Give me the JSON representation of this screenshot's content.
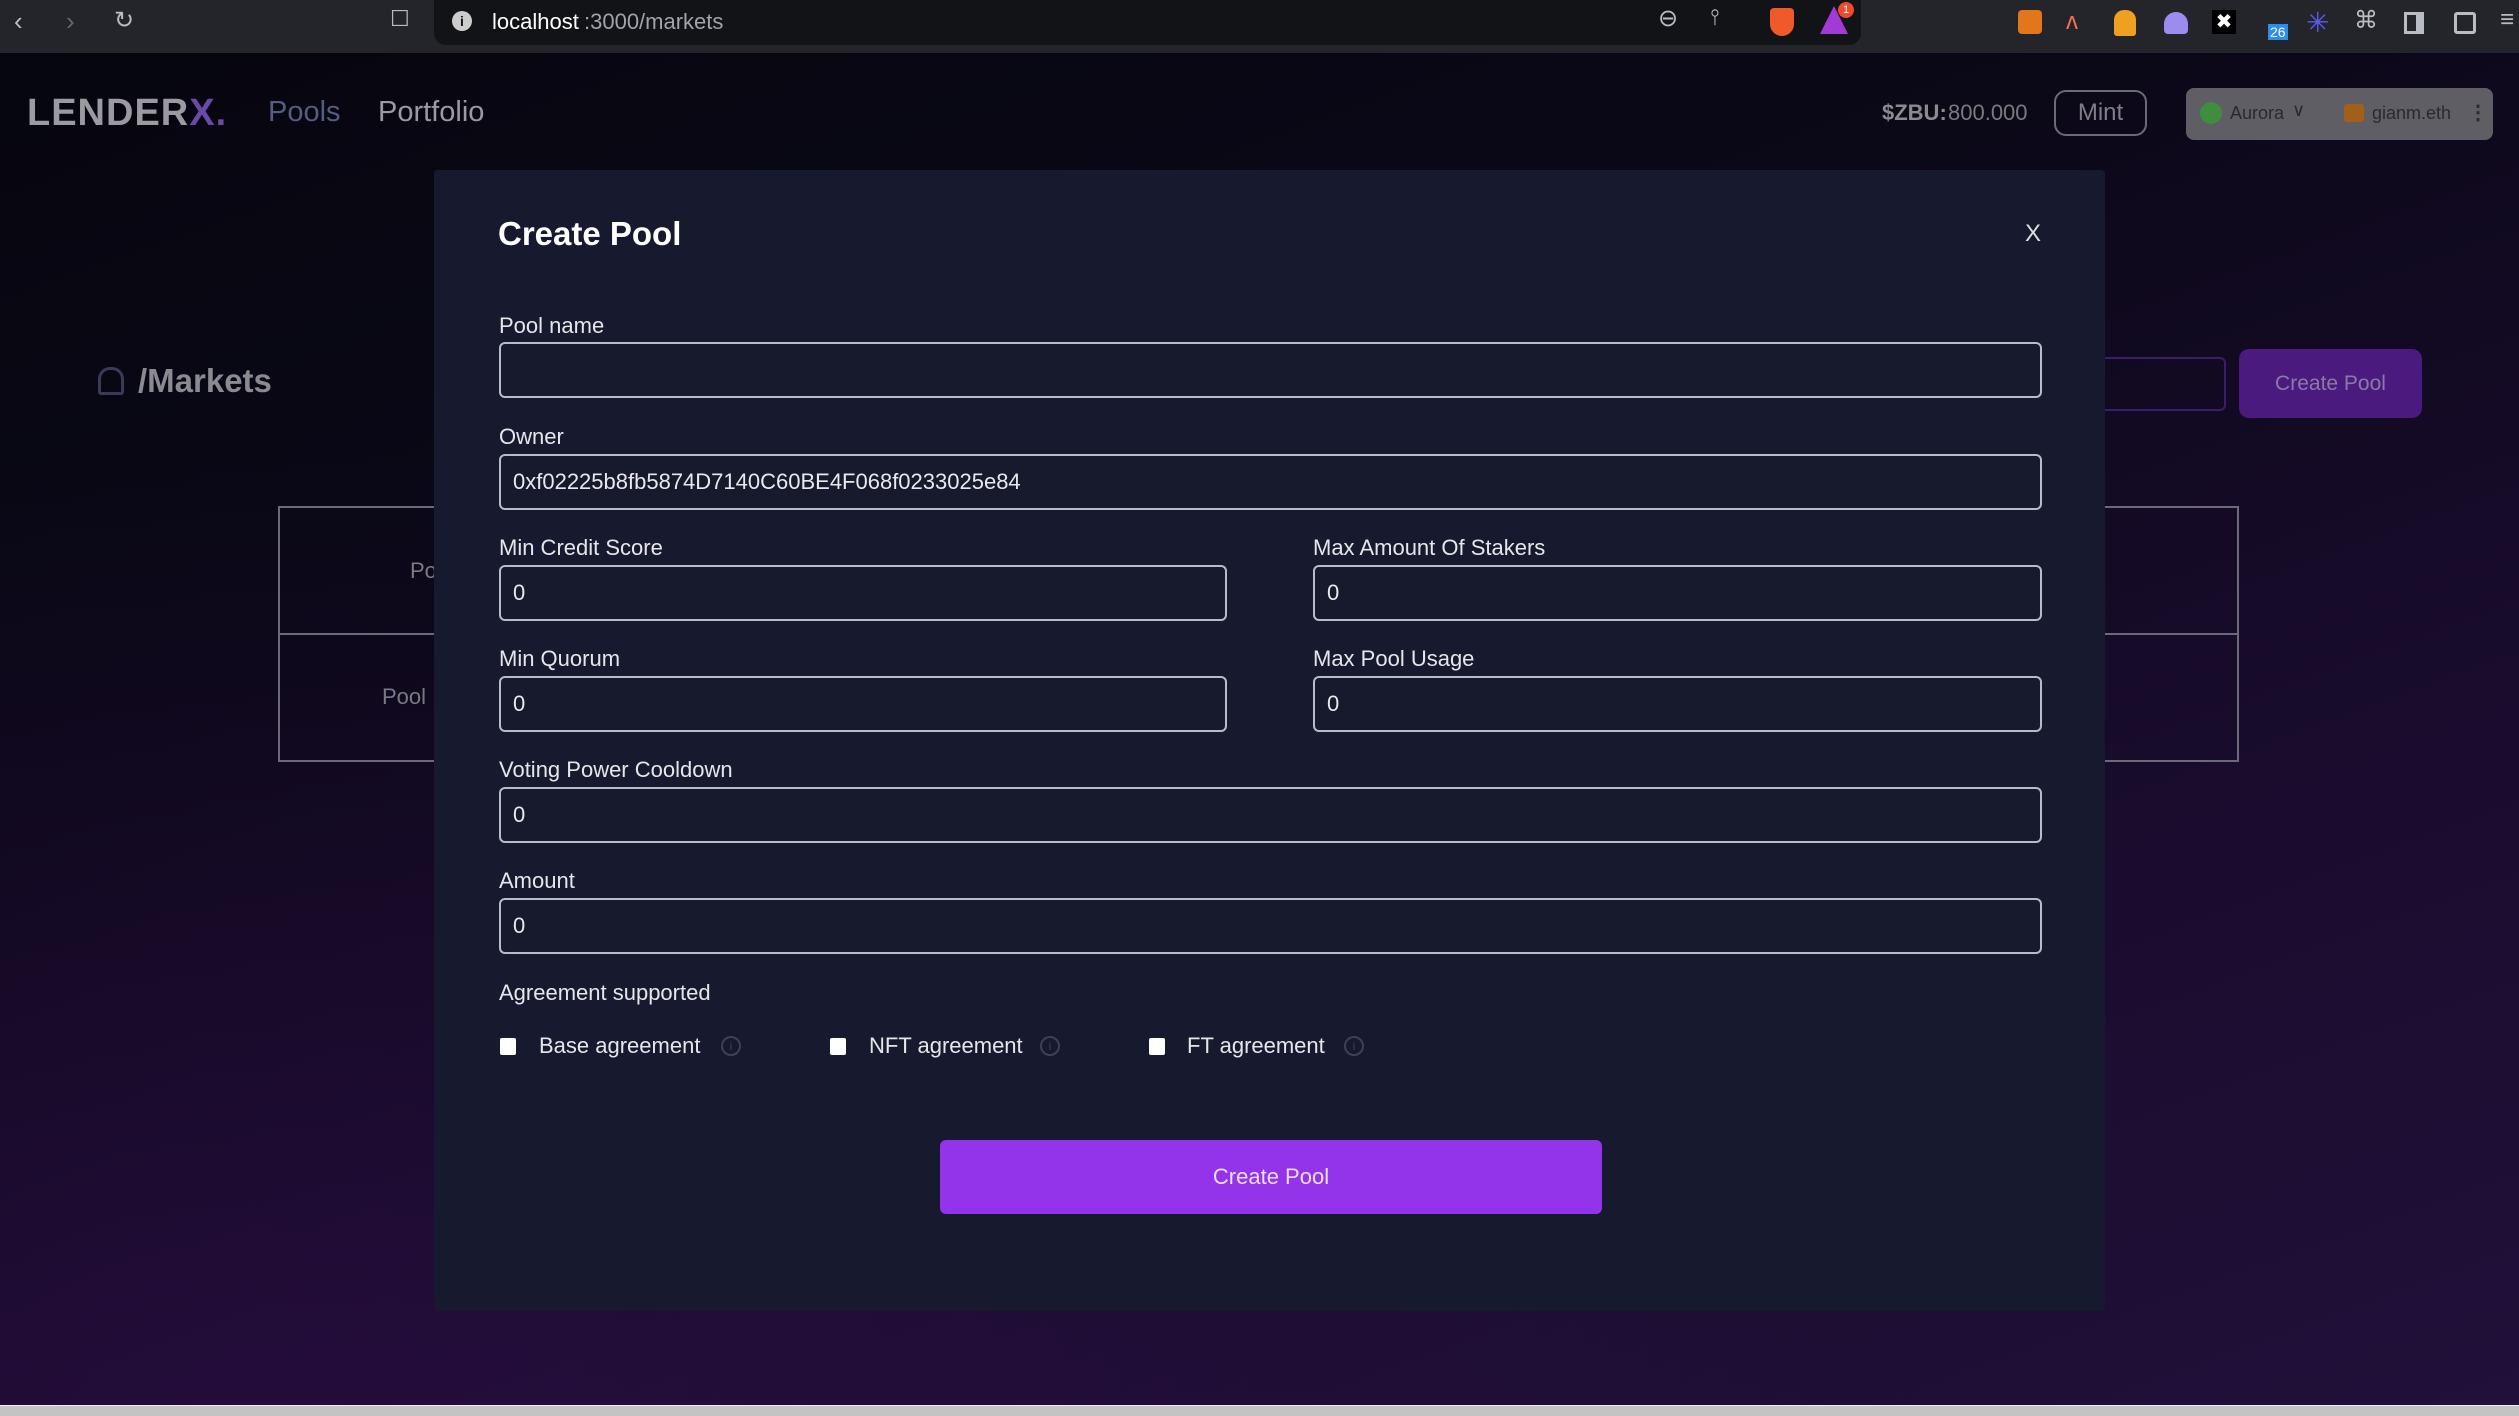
{
  "browser": {
    "url_host": "localhost",
    "url_path": ":3000/markets",
    "notification_count": "1",
    "extension_badge": "26"
  },
  "header": {
    "logo_main": "LENDER",
    "logo_accent": "X.",
    "nav": [
      "Pools",
      "Portfolio"
    ],
    "balance_label": "$ZBU:",
    "balance_value": "800.000",
    "mint_label": "Mint",
    "network": "Aurora",
    "account": "gianm.eth"
  },
  "page": {
    "breadcrumb": "/Markets",
    "create_pool_label": "Create Pool",
    "table_cells": [
      "Po",
      "Pool I"
    ]
  },
  "modal": {
    "title": "Create Pool",
    "close": "X",
    "fields": {
      "pool_name": {
        "label": "Pool name",
        "value": ""
      },
      "owner": {
        "label": "Owner",
        "value": "0xf02225b8fb5874D7140C60BE4F068f0233025e84"
      },
      "min_credit_score": {
        "label": "Min Credit Score",
        "value": "0"
      },
      "max_stakers": {
        "label": "Max Amount Of Stakers",
        "value": "0"
      },
      "min_quorum": {
        "label": "Min Quorum",
        "value": "0"
      },
      "max_pool_usage": {
        "label": "Max Pool Usage",
        "value": "0"
      },
      "voting_cooldown": {
        "label": "Voting Power Cooldown",
        "value": "0"
      },
      "amount": {
        "label": "Amount",
        "value": "0"
      }
    },
    "agreements_label": "Agreement supported",
    "agreements": [
      {
        "label": "Base agreement",
        "checked": false
      },
      {
        "label": "NFT agreement",
        "checked": false
      },
      {
        "label": "FT agreement",
        "checked": false
      }
    ],
    "submit_label": "Create Pool"
  },
  "colors": {
    "accent": "#9333ea",
    "modal_bg": "#171a2e"
  }
}
